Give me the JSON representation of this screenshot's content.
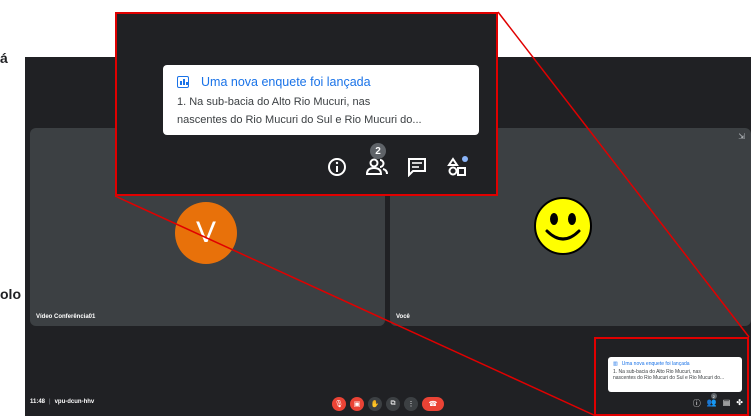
{
  "side_text": {
    "top": "á",
    "bottom": "olo"
  },
  "tiles": [
    {
      "name": "Vídeo Conferência01",
      "avatar": "V"
    },
    {
      "name": "Você"
    }
  ],
  "meeting": {
    "time": "11:48",
    "code": "vpu-dcun-hhv"
  },
  "notification": {
    "title": "Uma nova enquete foi lançada",
    "body_line1": "1. Na sub-bacia do Alto Rio Mucuri, nas",
    "body_line2": "nascentes do Rio Mucuri do Sul e Rio Mucuri do...",
    "icon": "poll-icon"
  },
  "toolbar": {
    "participants_count": "2",
    "icons": [
      "info-icon",
      "people-icon",
      "chat-icon",
      "activities-icon"
    ]
  },
  "controls": [
    "mic-off-icon",
    "camera-off-icon",
    "raise-hand-icon",
    "present-icon",
    "more-icon",
    "leave-call-icon"
  ],
  "colors": {
    "highlight": "#e00000",
    "accent": "#1a73e8",
    "background": "#202124",
    "tile": "#3c4043",
    "avatar": "#e8710a"
  }
}
